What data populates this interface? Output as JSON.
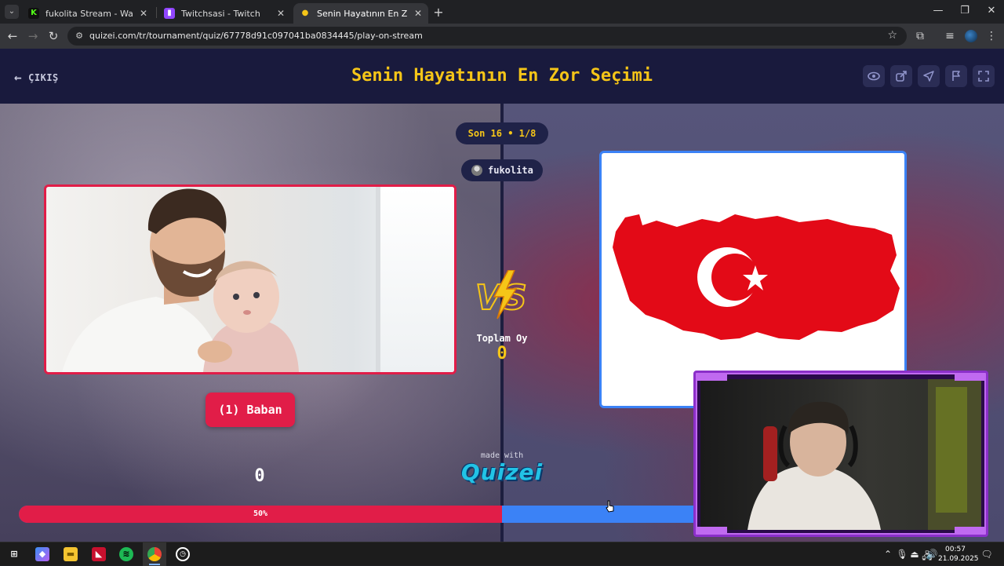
{
  "browser": {
    "tabs": [
      {
        "title": "fukolita Stream - Watch Live on",
        "favicon": "kick-icon",
        "favicon_color": "#53fc18"
      },
      {
        "title": "Twitchsasi - Twitch",
        "favicon": "twitch-icon",
        "favicon_color": "#9146ff"
      },
      {
        "title": "Senin Hayatının En Zor Seçimi",
        "favicon": "quizei-icon",
        "favicon_color": "#f5c518"
      }
    ],
    "url": "quizei.com/tr/tournament/quiz/67778d91c097041ba0834445/play-on-stream"
  },
  "header": {
    "exit_label": "ÇIKIŞ",
    "title": "Senin Hayatının En Zor Seçimi",
    "title_color": "#f5c518",
    "actions": [
      "eye-icon",
      "share-icon",
      "send-icon",
      "flag-icon",
      "fullscreen-icon"
    ]
  },
  "round": {
    "label": "Son 16 • 1/8"
  },
  "streamer": {
    "name": "fukolita"
  },
  "left_choice": {
    "label": "(1) Baban",
    "votes": "0",
    "image": "father-holding-baby-photo",
    "accent": "#e11d48"
  },
  "right_choice": {
    "image": "turkey-flag-map",
    "accent": "#3b82f6"
  },
  "totals": {
    "label": "Toplam Oy",
    "value": "0"
  },
  "progress": {
    "left_percent": 50,
    "label": "50%"
  },
  "branding": {
    "made_with": "made with",
    "name": "Quizei"
  },
  "taskbar": {
    "apps": [
      "start-icon",
      "copilot-icon",
      "explorer-icon",
      "amd-icon",
      "spotify-icon",
      "chrome-icon",
      "clock-app-icon"
    ],
    "time": "00:57",
    "date": "21.09.2025"
  }
}
